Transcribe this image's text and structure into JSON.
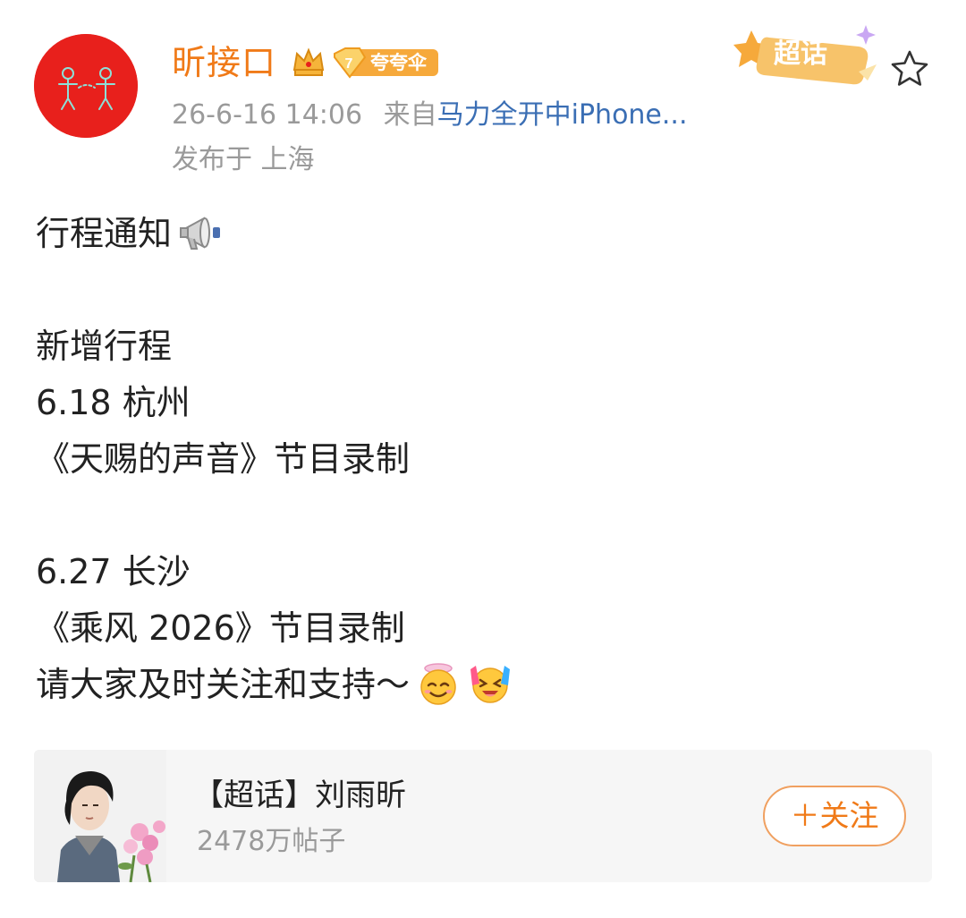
{
  "header": {
    "username": "昕接口",
    "level_badge": {
      "level": "7",
      "text": "夸夸伞"
    },
    "timestamp": "26-6-16 14:06",
    "source_prefix": "来自",
    "source": "马力全开中iPhone...",
    "location": "发布于 上海",
    "topic_sticker": "超话",
    "icons": {
      "crown": "crown-icon",
      "star": "star-icon",
      "sticker": "super-topic-sticker-icon"
    }
  },
  "post": {
    "lines": [
      "行程通知",
      "",
      "新增行程",
      "6.18 杭州",
      "《天赐的声音》节目录制",
      "",
      "6.27 长沙",
      "《乘风 2026》节目录制",
      "请大家及时关注和支持～"
    ],
    "emojis": {
      "announcement": "megaphone-icon",
      "angel": "angel-smile-emoji",
      "cheer": "cheer-emoji"
    }
  },
  "topic_card": {
    "title": "【超话】刘雨昕",
    "count": "2478万帖子",
    "follow_label": "＋关注"
  },
  "colors": {
    "username": "#f07a18",
    "source_link": "#3a6eb4",
    "meta_gray": "#9a9a9a",
    "avatar_bg": "#e8201c",
    "card_bg": "#f6f6f6",
    "follow_border": "#f0a060"
  }
}
